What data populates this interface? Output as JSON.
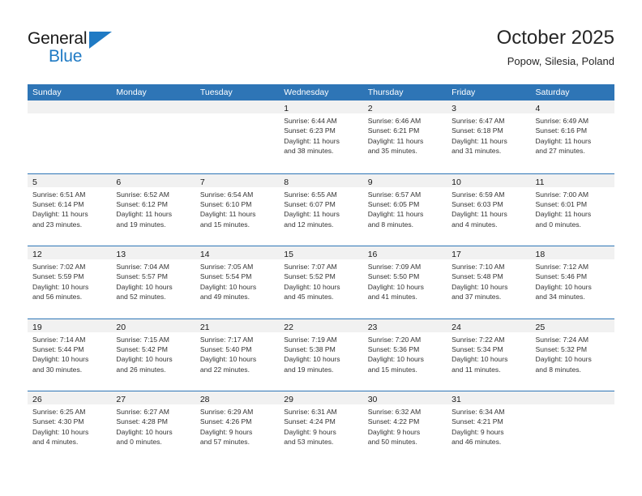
{
  "logo": {
    "word_top": "General",
    "word_bottom": "Blue",
    "triangle_icon": "blue-triangle-icon",
    "brand_color": "#1f7ac4"
  },
  "header": {
    "title": "October 2025",
    "subtitle": "Popow, Silesia, Poland"
  },
  "theme": {
    "header_blue": "#2e75b6",
    "date_band_gray": "#f1f1f1",
    "text_color": "#333333"
  },
  "weekdays": [
    "Sunday",
    "Monday",
    "Tuesday",
    "Wednesday",
    "Thursday",
    "Friday",
    "Saturday"
  ],
  "weeks": [
    [
      {
        "day": "",
        "empty": true
      },
      {
        "day": "",
        "empty": true
      },
      {
        "day": "",
        "empty": true
      },
      {
        "day": "1",
        "sunrise": "Sunrise: 6:44 AM",
        "sunset": "Sunset: 6:23 PM",
        "daylight1": "Daylight: 11 hours",
        "daylight2": "and 38 minutes."
      },
      {
        "day": "2",
        "sunrise": "Sunrise: 6:46 AM",
        "sunset": "Sunset: 6:21 PM",
        "daylight1": "Daylight: 11 hours",
        "daylight2": "and 35 minutes."
      },
      {
        "day": "3",
        "sunrise": "Sunrise: 6:47 AM",
        "sunset": "Sunset: 6:18 PM",
        "daylight1": "Daylight: 11 hours",
        "daylight2": "and 31 minutes."
      },
      {
        "day": "4",
        "sunrise": "Sunrise: 6:49 AM",
        "sunset": "Sunset: 6:16 PM",
        "daylight1": "Daylight: 11 hours",
        "daylight2": "and 27 minutes."
      }
    ],
    [
      {
        "day": "5",
        "sunrise": "Sunrise: 6:51 AM",
        "sunset": "Sunset: 6:14 PM",
        "daylight1": "Daylight: 11 hours",
        "daylight2": "and 23 minutes."
      },
      {
        "day": "6",
        "sunrise": "Sunrise: 6:52 AM",
        "sunset": "Sunset: 6:12 PM",
        "daylight1": "Daylight: 11 hours",
        "daylight2": "and 19 minutes."
      },
      {
        "day": "7",
        "sunrise": "Sunrise: 6:54 AM",
        "sunset": "Sunset: 6:10 PM",
        "daylight1": "Daylight: 11 hours",
        "daylight2": "and 15 minutes."
      },
      {
        "day": "8",
        "sunrise": "Sunrise: 6:55 AM",
        "sunset": "Sunset: 6:07 PM",
        "daylight1": "Daylight: 11 hours",
        "daylight2": "and 12 minutes."
      },
      {
        "day": "9",
        "sunrise": "Sunrise: 6:57 AM",
        "sunset": "Sunset: 6:05 PM",
        "daylight1": "Daylight: 11 hours",
        "daylight2": "and 8 minutes."
      },
      {
        "day": "10",
        "sunrise": "Sunrise: 6:59 AM",
        "sunset": "Sunset: 6:03 PM",
        "daylight1": "Daylight: 11 hours",
        "daylight2": "and 4 minutes."
      },
      {
        "day": "11",
        "sunrise": "Sunrise: 7:00 AM",
        "sunset": "Sunset: 6:01 PM",
        "daylight1": "Daylight: 11 hours",
        "daylight2": "and 0 minutes."
      }
    ],
    [
      {
        "day": "12",
        "sunrise": "Sunrise: 7:02 AM",
        "sunset": "Sunset: 5:59 PM",
        "daylight1": "Daylight: 10 hours",
        "daylight2": "and 56 minutes."
      },
      {
        "day": "13",
        "sunrise": "Sunrise: 7:04 AM",
        "sunset": "Sunset: 5:57 PM",
        "daylight1": "Daylight: 10 hours",
        "daylight2": "and 52 minutes."
      },
      {
        "day": "14",
        "sunrise": "Sunrise: 7:05 AM",
        "sunset": "Sunset: 5:54 PM",
        "daylight1": "Daylight: 10 hours",
        "daylight2": "and 49 minutes."
      },
      {
        "day": "15",
        "sunrise": "Sunrise: 7:07 AM",
        "sunset": "Sunset: 5:52 PM",
        "daylight1": "Daylight: 10 hours",
        "daylight2": "and 45 minutes."
      },
      {
        "day": "16",
        "sunrise": "Sunrise: 7:09 AM",
        "sunset": "Sunset: 5:50 PM",
        "daylight1": "Daylight: 10 hours",
        "daylight2": "and 41 minutes."
      },
      {
        "day": "17",
        "sunrise": "Sunrise: 7:10 AM",
        "sunset": "Sunset: 5:48 PM",
        "daylight1": "Daylight: 10 hours",
        "daylight2": "and 37 minutes."
      },
      {
        "day": "18",
        "sunrise": "Sunrise: 7:12 AM",
        "sunset": "Sunset: 5:46 PM",
        "daylight1": "Daylight: 10 hours",
        "daylight2": "and 34 minutes."
      }
    ],
    [
      {
        "day": "19",
        "sunrise": "Sunrise: 7:14 AM",
        "sunset": "Sunset: 5:44 PM",
        "daylight1": "Daylight: 10 hours",
        "daylight2": "and 30 minutes."
      },
      {
        "day": "20",
        "sunrise": "Sunrise: 7:15 AM",
        "sunset": "Sunset: 5:42 PM",
        "daylight1": "Daylight: 10 hours",
        "daylight2": "and 26 minutes."
      },
      {
        "day": "21",
        "sunrise": "Sunrise: 7:17 AM",
        "sunset": "Sunset: 5:40 PM",
        "daylight1": "Daylight: 10 hours",
        "daylight2": "and 22 minutes."
      },
      {
        "day": "22",
        "sunrise": "Sunrise: 7:19 AM",
        "sunset": "Sunset: 5:38 PM",
        "daylight1": "Daylight: 10 hours",
        "daylight2": "and 19 minutes."
      },
      {
        "day": "23",
        "sunrise": "Sunrise: 7:20 AM",
        "sunset": "Sunset: 5:36 PM",
        "daylight1": "Daylight: 10 hours",
        "daylight2": "and 15 minutes."
      },
      {
        "day": "24",
        "sunrise": "Sunrise: 7:22 AM",
        "sunset": "Sunset: 5:34 PM",
        "daylight1": "Daylight: 10 hours",
        "daylight2": "and 11 minutes."
      },
      {
        "day": "25",
        "sunrise": "Sunrise: 7:24 AM",
        "sunset": "Sunset: 5:32 PM",
        "daylight1": "Daylight: 10 hours",
        "daylight2": "and 8 minutes."
      }
    ],
    [
      {
        "day": "26",
        "sunrise": "Sunrise: 6:25 AM",
        "sunset": "Sunset: 4:30 PM",
        "daylight1": "Daylight: 10 hours",
        "daylight2": "and 4 minutes."
      },
      {
        "day": "27",
        "sunrise": "Sunrise: 6:27 AM",
        "sunset": "Sunset: 4:28 PM",
        "daylight1": "Daylight: 10 hours",
        "daylight2": "and 0 minutes."
      },
      {
        "day": "28",
        "sunrise": "Sunrise: 6:29 AM",
        "sunset": "Sunset: 4:26 PM",
        "daylight1": "Daylight: 9 hours",
        "daylight2": "and 57 minutes."
      },
      {
        "day": "29",
        "sunrise": "Sunrise: 6:31 AM",
        "sunset": "Sunset: 4:24 PM",
        "daylight1": "Daylight: 9 hours",
        "daylight2": "and 53 minutes."
      },
      {
        "day": "30",
        "sunrise": "Sunrise: 6:32 AM",
        "sunset": "Sunset: 4:22 PM",
        "daylight1": "Daylight: 9 hours",
        "daylight2": "and 50 minutes."
      },
      {
        "day": "31",
        "sunrise": "Sunrise: 6:34 AM",
        "sunset": "Sunset: 4:21 PM",
        "daylight1": "Daylight: 9 hours",
        "daylight2": "and 46 minutes."
      },
      {
        "day": "",
        "empty": true
      }
    ]
  ]
}
